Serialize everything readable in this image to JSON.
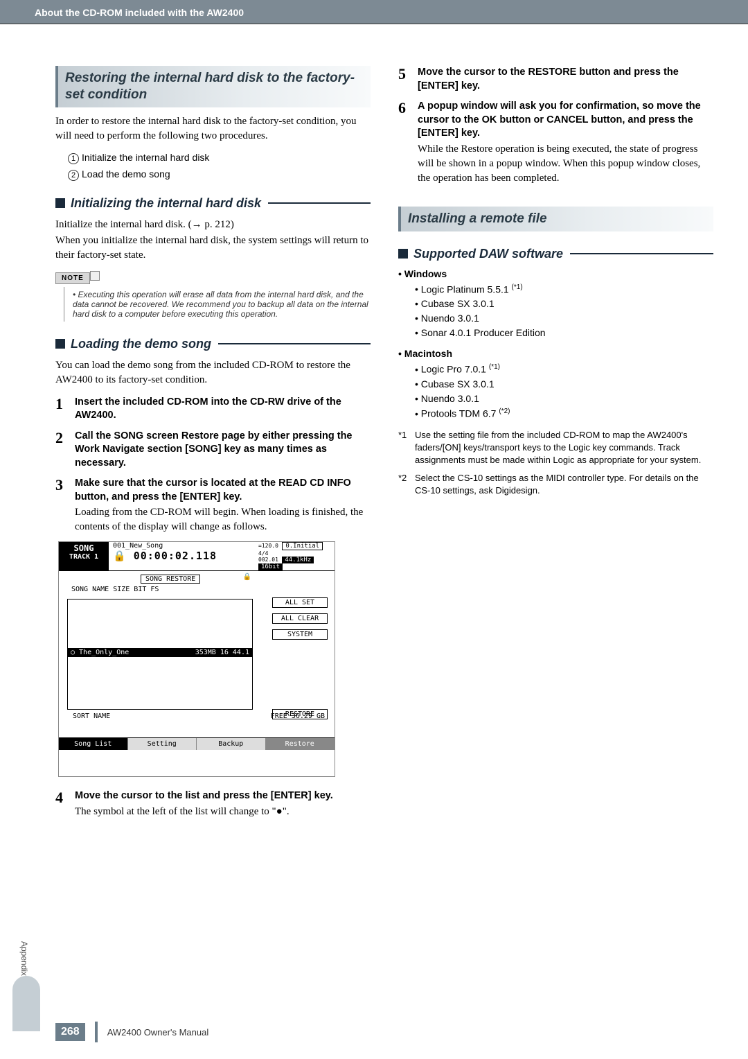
{
  "header": {
    "breadcrumb": "About the CD-ROM included with the AW2400"
  },
  "left": {
    "sec1_title": "Restoring the internal hard disk to the factory-set condition",
    "sec1_intro": "In order to restore the internal hard disk to the factory-set condition, you will need to perform the following two procedures.",
    "proc1": "Initialize the internal hard disk",
    "proc2": "Load the demo song",
    "sub1": "Initializing the internal hard disk",
    "sub1_p1": "Initialize the internal hard disk. (→ p. 212)",
    "sub1_p2": "When you initialize the internal hard disk, the system settings will return to their factory-set state.",
    "note_label": "NOTE",
    "note_text": "• Executing this operation will erase all data from the internal hard disk, and the data cannot be recovered. We recommend you to backup all data on the internal hard disk to a computer before executing this operation.",
    "sub2": "Loading the demo song",
    "sub2_intro": "You can load the demo song from the included CD-ROM to restore the AW2400 to its factory-set condition.",
    "steps": {
      "1": {
        "bold": "Insert the included CD-ROM into the CD-RW drive of the AW2400."
      },
      "2": {
        "bold": "Call the SONG screen Restore page by either pressing the Work Navigate section [SONG] key as many times as necessary."
      },
      "3": {
        "bold": "Make sure that the cursor is located at the READ CD INFO button, and press the [ENTER] key.",
        "desc": "Loading from the CD-ROM will begin. When loading is finished, the contents of the display will change as follows."
      },
      "4": {
        "bold": "Move the cursor to the list and press the [ENTER] key.",
        "desc": "The symbol at the left of the list will change to \"●\"."
      }
    },
    "screenshot": {
      "title_song": "SONG",
      "title_track": "TRACK 1",
      "song_name_top": "001_New_Song",
      "time": "00:00:02.118",
      "tempo": "=120.0",
      "tempo2": "4/4",
      "scene": "0.Initial",
      "remain": "002.01",
      "rate": "44.1kHz",
      "bit": "16bit",
      "restore_tab": "SONG RESTORE",
      "cols": "SONG NAME          SIZE  BIT FS",
      "all_set": "ALL SET",
      "all_clear": "ALL CLEAR",
      "system": "SYSTEM",
      "list_item": "○ The_Only_One",
      "list_size": "353MB  16 44.1",
      "restore_btn": "RESTORE",
      "sort": "SORT NAME",
      "free": "FREE  36.29 GB",
      "tab_songlist": "Song List",
      "tab_setting": "Setting",
      "tab_backup": "Backup",
      "tab_restore": "Restore",
      "lock": "🔒"
    }
  },
  "right": {
    "steps": {
      "5": {
        "bold": "Move the cursor to the RESTORE button and press the [ENTER] key."
      },
      "6": {
        "bold": "A popup window will ask you for confirmation, so move the cursor to the OK button or CANCEL button, and press the [ENTER] key.",
        "desc": "While the Restore operation is being executed, the state of progress will be shown in a popup window. When this popup window closes, the operation has been completed."
      }
    },
    "sec2_title": "Installing a remote file",
    "sub3": "Supported DAW software",
    "windows": {
      "heading": "• Windows",
      "items": [
        "Logic Platinum 5.5.1",
        "Cubase SX 3.0.1",
        "Nuendo 3.0.1",
        "Sonar 4.0.1 Producer Edition"
      ]
    },
    "mac": {
      "heading": "• Macintosh",
      "items": [
        "Logic Pro 7.0.1",
        "Cubase SX 3.0.1",
        "Nuendo 3.0.1",
        "Protools TDM 6.7"
      ]
    },
    "sup1": "(*1)",
    "sup2": "(*2)",
    "footnote1": "Use the setting file from the included CD-ROM to map the AW2400's faders/[ON] keys/transport keys to the Logic key commands. Track assignments must be made within Logic as appropriate for your system.",
    "footnote2": "Select the CS-10 settings as the MIDI controller type. For details on the CS-10 settings, ask Digidesign.",
    "fn1_label": "*1",
    "fn2_label": "*2"
  },
  "side": {
    "appendix": "Appendix"
  },
  "footer": {
    "page": "268",
    "manual": "AW2400  Owner's Manual"
  }
}
